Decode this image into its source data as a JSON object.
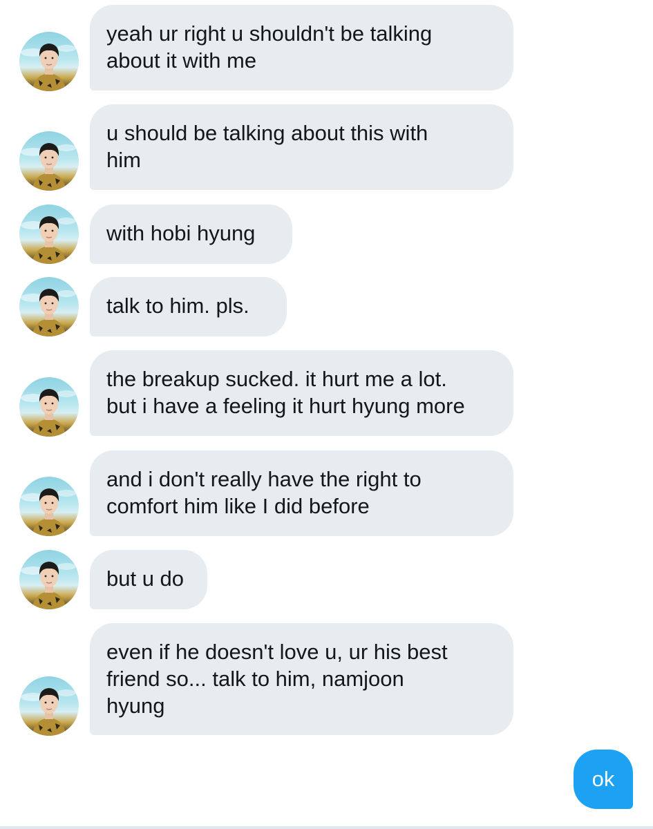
{
  "conversation": {
    "incoming": [
      {
        "text": "yeah ur right u shouldn't be talking\nabout it with me"
      },
      {
        "text": "u should be talking about this with\nhim"
      },
      {
        "text": "with hobi hyung"
      },
      {
        "text": "talk to him. pls."
      },
      {
        "text": "the breakup sucked. it hurt me a lot.\nbut i have a feeling it hurt hyung more"
      },
      {
        "text": "and i don't really have the right to\ncomfort him like I did before"
      },
      {
        "text": "but u do"
      },
      {
        "text": "even if he doesn't love u, ur his best\nfriend so... talk to him, namjoon\nhyung"
      }
    ],
    "outgoing": [
      {
        "text": "ok"
      }
    ]
  },
  "colors": {
    "incoming_bubble": "#e7ecf0",
    "outgoing_bubble": "#1da1f2",
    "text_dark": "#14171a",
    "text_light": "#ffffff"
  },
  "icons": {
    "avatar": "avatar-photo-icon"
  }
}
